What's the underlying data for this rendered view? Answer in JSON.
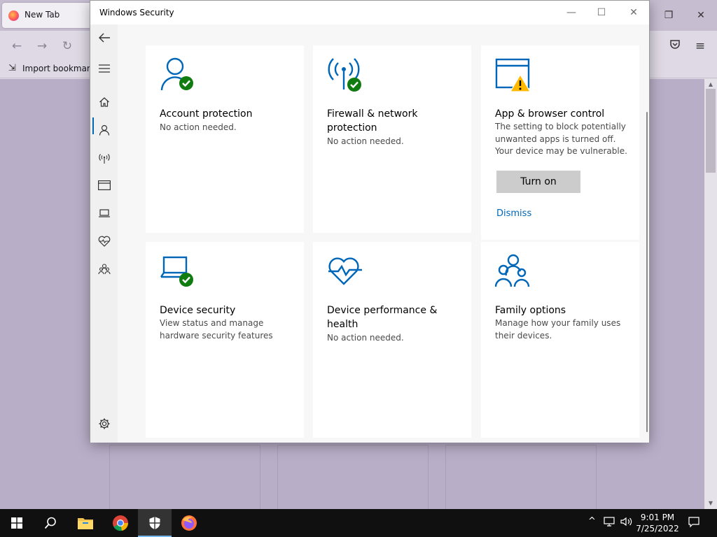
{
  "firefox": {
    "tab_title": "New Tab",
    "bookmarks_import_label": "Import bookmarks..."
  },
  "security_window": {
    "title": "Windows Security",
    "accent_color": "#0067b8",
    "ok_color": "#107c10",
    "warning_color": "#ffb900",
    "cards": [
      {
        "title": "Account protection",
        "description": "No action needed.",
        "icon": "account-shield-ok-icon",
        "status": "ok"
      },
      {
        "title": "Firewall & network protection",
        "description": "No action needed.",
        "icon": "firewall-antenna-ok-icon",
        "status": "ok"
      },
      {
        "title": "App & browser control",
        "description": "The setting to block potentially unwanted apps is turned off. Your device may be vulnerable.",
        "icon": "app-browser-warning-icon",
        "status": "warning",
        "action_label": "Turn on",
        "dismiss_label": "Dismiss"
      },
      {
        "title": "Device security",
        "description": "View status and manage hardware security features",
        "icon": "laptop-ok-icon",
        "status": "ok"
      },
      {
        "title": "Device performance & health",
        "description": "No action needed.",
        "icon": "heart-pulse-icon",
        "status": "ok"
      },
      {
        "title": "Family options",
        "description": "Manage how your family uses their devices.",
        "icon": "family-icon",
        "status": "info"
      }
    ]
  },
  "taskbar": {
    "time": "9:01 PM",
    "date": "7/25/2022"
  }
}
